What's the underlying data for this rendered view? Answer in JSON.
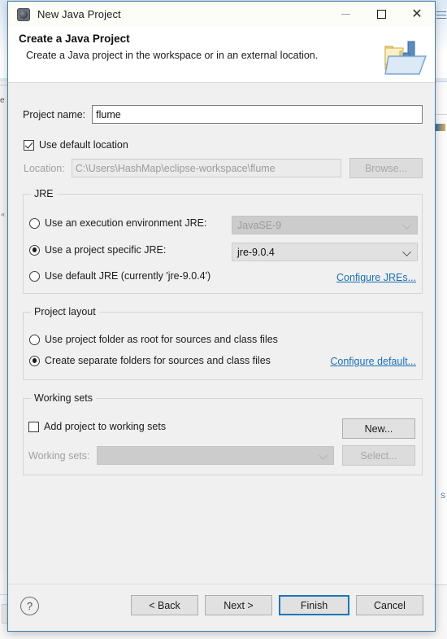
{
  "window": {
    "title": "New Java Project",
    "title_icon": "java-project-gear-icon",
    "minimize_label": "Minimize",
    "maximize_label": "Maximize",
    "close_label": "Close",
    "accent_color": "#1c77b8",
    "border_color": "#3f7fa8"
  },
  "header": {
    "title": "Create a Java Project",
    "description": "Create a Java project in the workspace or in an external location.",
    "icon": "java-project-folder-icon"
  },
  "project_name": {
    "label": "Project name:",
    "value": "flume",
    "placeholder": ""
  },
  "location": {
    "use_default_label": "Use default location",
    "use_default_checked": true,
    "label": "Location:",
    "value": "C:\\Users\\HashMap\\eclipse-workspace\\flume",
    "browse_label": "Browse...",
    "browse_enabled": false,
    "field_enabled": false
  },
  "jre": {
    "legend": "JRE",
    "options": [
      {
        "id": "execution-environment",
        "label": "Use an execution environment JRE:",
        "selected": false,
        "combo_value": "JavaSE-9",
        "combo_enabled": false
      },
      {
        "id": "project-specific",
        "label": "Use a project specific JRE:",
        "selected": true,
        "combo_value": "jre-9.0.4",
        "combo_enabled": true
      },
      {
        "id": "default-jre",
        "label": "Use default JRE (currently 'jre-9.0.4')",
        "selected": false
      }
    ],
    "configure_link": "Configure JREs..."
  },
  "project_layout": {
    "legend": "Project layout",
    "options": [
      {
        "id": "project-folder-root",
        "label": "Use project folder as root for sources and class files",
        "selected": false
      },
      {
        "id": "separate-folders",
        "label": "Create separate folders for sources and class files",
        "selected": true
      }
    ],
    "configure_link": "Configure default..."
  },
  "working_sets": {
    "legend": "Working sets",
    "add_label": "Add project to working sets",
    "add_checked": false,
    "new_label": "New...",
    "new_enabled": true,
    "sets_label": "Working sets:",
    "sets_value": "",
    "sets_enabled": false,
    "select_label": "Select...",
    "select_enabled": false
  },
  "buttons": {
    "help": "?",
    "back": "< Back",
    "next": "Next >",
    "finish": "Finish",
    "cancel": "Cancel",
    "default_button": "Finish"
  }
}
